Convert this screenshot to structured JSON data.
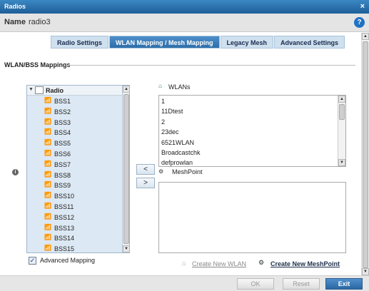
{
  "window": {
    "title": "Radios",
    "close_label": "×"
  },
  "name_bar": {
    "label": "Name",
    "value": "radio3",
    "help_label": "?"
  },
  "tabs": [
    {
      "label": "Radio Settings",
      "active": false
    },
    {
      "label": "WLAN Mapping / Mesh Mapping",
      "active": true
    },
    {
      "label": "Legacy Mesh",
      "active": false
    },
    {
      "label": "Advanced Settings",
      "active": false
    }
  ],
  "section": {
    "title": "WLAN/BSS Mappings",
    "info_label": "i"
  },
  "tree": {
    "root_label": "Radio",
    "items": [
      "BSS1",
      "BSS2",
      "BSS3",
      "BSS4",
      "BSS5",
      "BSS6",
      "BSS7",
      "BSS8",
      "BSS9",
      "BSS10",
      "BSS11",
      "BSS12",
      "BSS13",
      "BSS14",
      "BSS15"
    ]
  },
  "move": {
    "left_label": "<",
    "right_label": ">"
  },
  "wlans": {
    "header": "WLANs",
    "items": [
      "1",
      "11Dtest",
      "2",
      "23dec",
      "6521WLAN",
      "Broadcastchk",
      "defprowlan"
    ]
  },
  "meshpoint": {
    "header": "MeshPoint"
  },
  "advanced_mapping": {
    "label": "Advanced Mapping",
    "checked": true,
    "check_mark": "✓"
  },
  "links": {
    "create_wlan": "Create New WLAN",
    "create_meshpoint": "Create New MeshPoint"
  },
  "footer": {
    "ok_label": "OK",
    "reset_label": "Reset",
    "exit_label": "Exit"
  },
  "colors": {
    "titlebar": "#2f76b5",
    "accent_tab": "#3d80bf",
    "tree_bg": "#dce8f3"
  }
}
